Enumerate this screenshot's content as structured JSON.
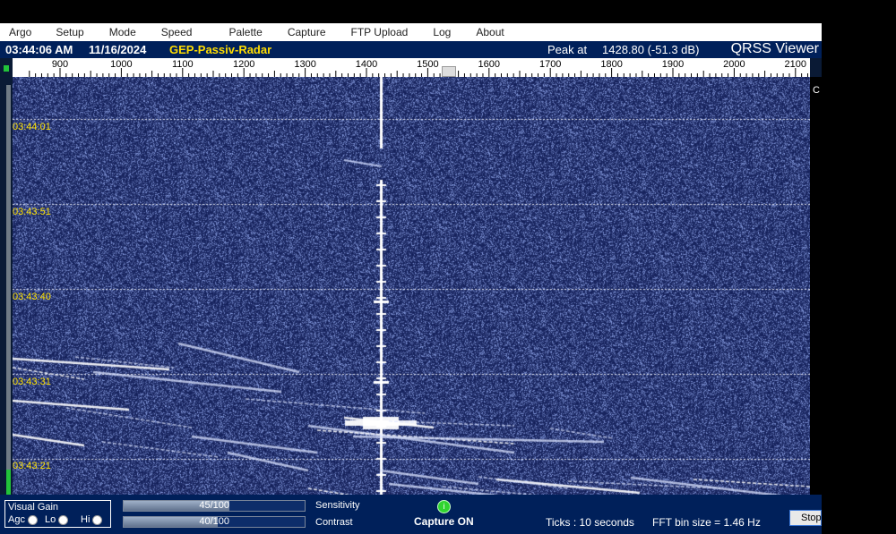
{
  "menu": [
    "Argo",
    "Setup",
    "Mode",
    "Speed",
    "Palette",
    "Capture",
    "FTP Upload",
    "Log",
    "About"
  ],
  "status": {
    "time": "03:44:06 AM",
    "date": "11/16/2024",
    "station": "GEP-Passiv-Radar",
    "peak_label": "Peak at",
    "peak_value": "1428.80 (-51.3 dB)",
    "app_name": "QRSS Viewer"
  },
  "ruler": {
    "labels": [
      "900",
      "1000",
      "1100",
      "1200",
      "1300",
      "1400",
      "1500",
      "1600",
      "1700",
      "1800",
      "1900",
      "2000",
      "2100"
    ]
  },
  "waterfall": {
    "time_labels": [
      "03:44:01",
      "03:43:51",
      "03:43:40",
      "03:43:31",
      "03:43:21"
    ],
    "right_edge_char": "C",
    "carrier_freq_hz": 1428.8
  },
  "controls": {
    "visual_gain_title": "Visual Gain",
    "agc_label": "Agc",
    "lo_label": "Lo",
    "hi_label": "Hi",
    "sensitivity_value": "45/100",
    "sensitivity_fraction": 0.45,
    "contrast_value": "40/100",
    "contrast_fraction": 0.4,
    "sensitivity_label": "Sensitivity",
    "contrast_label": "Contrast",
    "capture_led_text": "i",
    "capture_label": "Capture ON",
    "ticks_label": "Ticks  : 10 seconds",
    "fft_label": "FFT bin size = 1.46 Hz",
    "stop_label": "Stop"
  },
  "colors": {
    "waterfall_bg": "#1b2b6a",
    "label_yellow": "#ffe200",
    "led_green": "#2fd42f"
  }
}
